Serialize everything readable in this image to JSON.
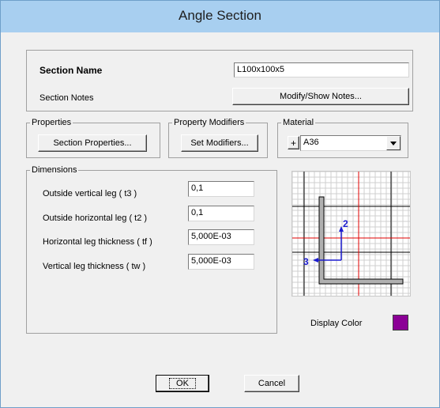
{
  "window": {
    "title": "Angle Section"
  },
  "section": {
    "name_label": "Section Name",
    "name_value": "L100x100x5",
    "notes_label": "Section Notes",
    "notes_button": "Modify/Show Notes..."
  },
  "properties": {
    "legend": "Properties",
    "button": "Section Properties..."
  },
  "modifiers": {
    "legend": "Property Modifiers",
    "button": "Set Modifiers..."
  },
  "material": {
    "legend": "Material",
    "plus": "+",
    "value": "A36"
  },
  "dimensions": {
    "legend": "Dimensions",
    "rows": [
      {
        "label": "Outside vertical leg  ( t3 )",
        "value": "0,1"
      },
      {
        "label": "Outside horizontal leg  ( t2 )",
        "value": "0,1"
      },
      {
        "label": "Horizontal leg thickness  ( tf )",
        "value": "5,000E-03"
      },
      {
        "label": "Vertical leg thickness  ( tw )",
        "value": "5,000E-03"
      }
    ]
  },
  "preview": {
    "axis2": "2",
    "axis3": "3",
    "gridline_color": "#e00000",
    "section_color": "#b0b0b0"
  },
  "display_color": {
    "label": "Display Color",
    "color": "#8b0096"
  },
  "buttons": {
    "ok": "OK",
    "cancel": "Cancel"
  }
}
